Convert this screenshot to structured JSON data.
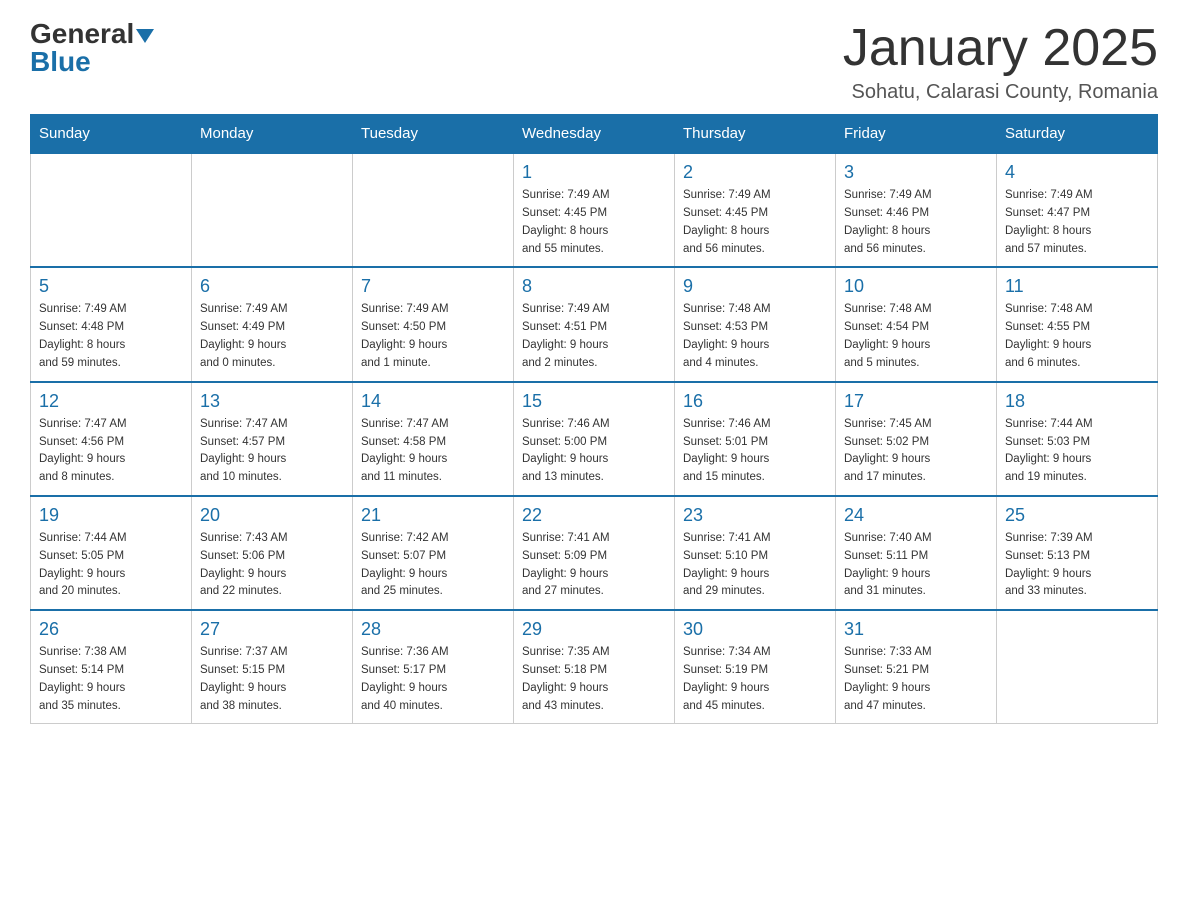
{
  "logo": {
    "line1": "General",
    "line2": "Blue"
  },
  "title": "January 2025",
  "subtitle": "Sohatu, Calarasi County, Romania",
  "days_of_week": [
    "Sunday",
    "Monday",
    "Tuesday",
    "Wednesday",
    "Thursday",
    "Friday",
    "Saturday"
  ],
  "weeks": [
    [
      {
        "day": "",
        "info": ""
      },
      {
        "day": "",
        "info": ""
      },
      {
        "day": "",
        "info": ""
      },
      {
        "day": "1",
        "info": "Sunrise: 7:49 AM\nSunset: 4:45 PM\nDaylight: 8 hours\nand 55 minutes."
      },
      {
        "day": "2",
        "info": "Sunrise: 7:49 AM\nSunset: 4:45 PM\nDaylight: 8 hours\nand 56 minutes."
      },
      {
        "day": "3",
        "info": "Sunrise: 7:49 AM\nSunset: 4:46 PM\nDaylight: 8 hours\nand 56 minutes."
      },
      {
        "day": "4",
        "info": "Sunrise: 7:49 AM\nSunset: 4:47 PM\nDaylight: 8 hours\nand 57 minutes."
      }
    ],
    [
      {
        "day": "5",
        "info": "Sunrise: 7:49 AM\nSunset: 4:48 PM\nDaylight: 8 hours\nand 59 minutes."
      },
      {
        "day": "6",
        "info": "Sunrise: 7:49 AM\nSunset: 4:49 PM\nDaylight: 9 hours\nand 0 minutes."
      },
      {
        "day": "7",
        "info": "Sunrise: 7:49 AM\nSunset: 4:50 PM\nDaylight: 9 hours\nand 1 minute."
      },
      {
        "day": "8",
        "info": "Sunrise: 7:49 AM\nSunset: 4:51 PM\nDaylight: 9 hours\nand 2 minutes."
      },
      {
        "day": "9",
        "info": "Sunrise: 7:48 AM\nSunset: 4:53 PM\nDaylight: 9 hours\nand 4 minutes."
      },
      {
        "day": "10",
        "info": "Sunrise: 7:48 AM\nSunset: 4:54 PM\nDaylight: 9 hours\nand 5 minutes."
      },
      {
        "day": "11",
        "info": "Sunrise: 7:48 AM\nSunset: 4:55 PM\nDaylight: 9 hours\nand 6 minutes."
      }
    ],
    [
      {
        "day": "12",
        "info": "Sunrise: 7:47 AM\nSunset: 4:56 PM\nDaylight: 9 hours\nand 8 minutes."
      },
      {
        "day": "13",
        "info": "Sunrise: 7:47 AM\nSunset: 4:57 PM\nDaylight: 9 hours\nand 10 minutes."
      },
      {
        "day": "14",
        "info": "Sunrise: 7:47 AM\nSunset: 4:58 PM\nDaylight: 9 hours\nand 11 minutes."
      },
      {
        "day": "15",
        "info": "Sunrise: 7:46 AM\nSunset: 5:00 PM\nDaylight: 9 hours\nand 13 minutes."
      },
      {
        "day": "16",
        "info": "Sunrise: 7:46 AM\nSunset: 5:01 PM\nDaylight: 9 hours\nand 15 minutes."
      },
      {
        "day": "17",
        "info": "Sunrise: 7:45 AM\nSunset: 5:02 PM\nDaylight: 9 hours\nand 17 minutes."
      },
      {
        "day": "18",
        "info": "Sunrise: 7:44 AM\nSunset: 5:03 PM\nDaylight: 9 hours\nand 19 minutes."
      }
    ],
    [
      {
        "day": "19",
        "info": "Sunrise: 7:44 AM\nSunset: 5:05 PM\nDaylight: 9 hours\nand 20 minutes."
      },
      {
        "day": "20",
        "info": "Sunrise: 7:43 AM\nSunset: 5:06 PM\nDaylight: 9 hours\nand 22 minutes."
      },
      {
        "day": "21",
        "info": "Sunrise: 7:42 AM\nSunset: 5:07 PM\nDaylight: 9 hours\nand 25 minutes."
      },
      {
        "day": "22",
        "info": "Sunrise: 7:41 AM\nSunset: 5:09 PM\nDaylight: 9 hours\nand 27 minutes."
      },
      {
        "day": "23",
        "info": "Sunrise: 7:41 AM\nSunset: 5:10 PM\nDaylight: 9 hours\nand 29 minutes."
      },
      {
        "day": "24",
        "info": "Sunrise: 7:40 AM\nSunset: 5:11 PM\nDaylight: 9 hours\nand 31 minutes."
      },
      {
        "day": "25",
        "info": "Sunrise: 7:39 AM\nSunset: 5:13 PM\nDaylight: 9 hours\nand 33 minutes."
      }
    ],
    [
      {
        "day": "26",
        "info": "Sunrise: 7:38 AM\nSunset: 5:14 PM\nDaylight: 9 hours\nand 35 minutes."
      },
      {
        "day": "27",
        "info": "Sunrise: 7:37 AM\nSunset: 5:15 PM\nDaylight: 9 hours\nand 38 minutes."
      },
      {
        "day": "28",
        "info": "Sunrise: 7:36 AM\nSunset: 5:17 PM\nDaylight: 9 hours\nand 40 minutes."
      },
      {
        "day": "29",
        "info": "Sunrise: 7:35 AM\nSunset: 5:18 PM\nDaylight: 9 hours\nand 43 minutes."
      },
      {
        "day": "30",
        "info": "Sunrise: 7:34 AM\nSunset: 5:19 PM\nDaylight: 9 hours\nand 45 minutes."
      },
      {
        "day": "31",
        "info": "Sunrise: 7:33 AM\nSunset: 5:21 PM\nDaylight: 9 hours\nand 47 minutes."
      },
      {
        "day": "",
        "info": ""
      }
    ]
  ]
}
